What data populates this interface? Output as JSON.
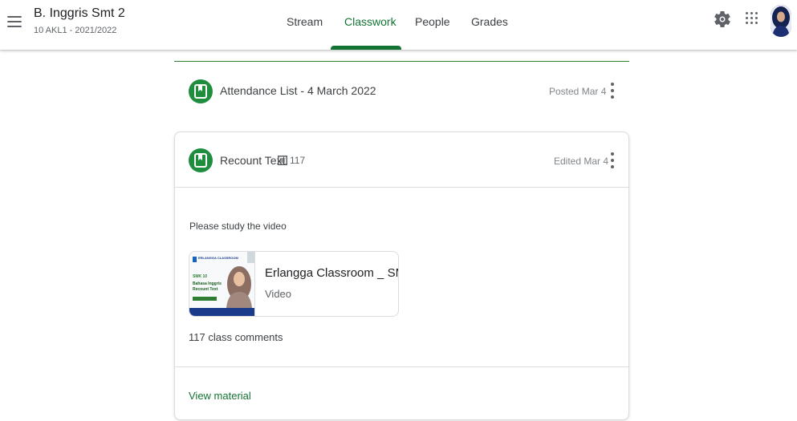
{
  "header": {
    "class_title": "B. Inggris Smt 2",
    "class_subtitle": "10 AKL1 - 2021/2022",
    "menu_icon": "hamburger-menu-icon",
    "settings_icon": "gear-icon",
    "apps_icon": "apps-grid-icon"
  },
  "tabs": [
    {
      "label": "Stream",
      "active": false
    },
    {
      "label": "Classwork",
      "active": true
    },
    {
      "label": "People",
      "active": false
    },
    {
      "label": "Grades",
      "active": false
    }
  ],
  "colors": {
    "accent": "#137333",
    "icon_green": "#1e8e3e",
    "divider": "#dadce0"
  },
  "items": [
    {
      "icon": "material-bookmark-icon",
      "title": "Attendance List - 4 March 2022",
      "date": "Posted Mar 4"
    }
  ],
  "card": {
    "icon": "material-bookmark-icon",
    "title": "Recount Text",
    "comment_icon": "comment-icon",
    "comment_count": "117",
    "date": "Edited Mar 4",
    "description": "Please study the video",
    "attachment": {
      "title": "Erlangga Classroom _ SM...",
      "type": "Video",
      "thumb_brand": "ERLANGGA CLASSROOM",
      "thumb_level": "SMK 10",
      "thumb_subject": "Bahasa Inggris",
      "thumb_topic": "Recount Text"
    },
    "comments_label": "117 class comments",
    "view_label": "View material"
  }
}
